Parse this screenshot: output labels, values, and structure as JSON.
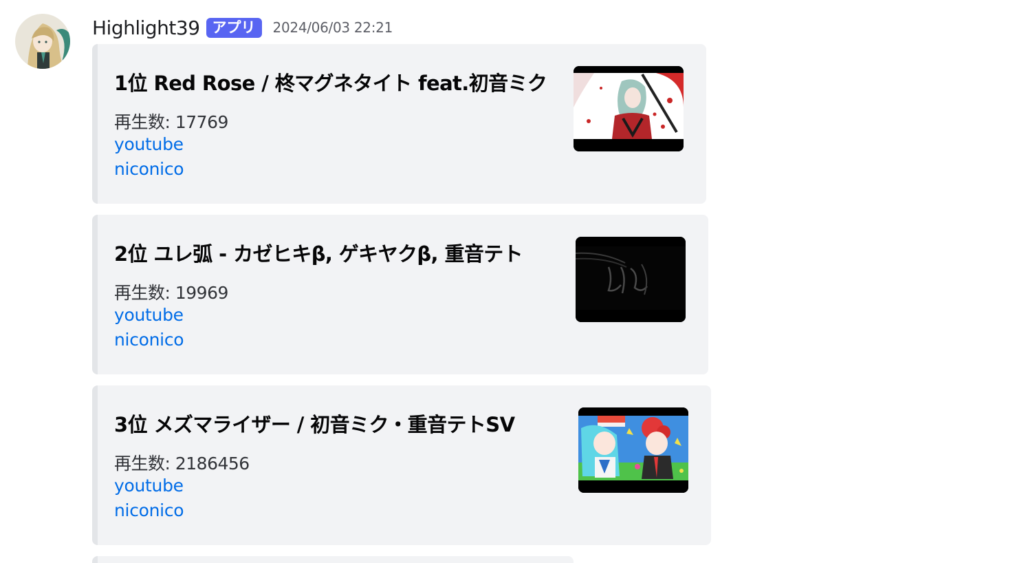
{
  "author": {
    "username": "Highlight39",
    "badge": "アプリ",
    "timestamp": "2024/06/03 22:21",
    "avatar_icon": "anime-character-avatar"
  },
  "embeds": [
    {
      "title": "1位  Red Rose / 柊マグネタイト feat.初音ミク",
      "plays": "再生数: 17769",
      "link_youtube": "youtube",
      "link_niconico": "niconico",
      "thumbnail_icon": "red-rose-thumbnail"
    },
    {
      "title": "2位  ユレ弧 - カゼヒキβ, ゲキヤクβ, 重音テト",
      "plays": "再生数: 19969",
      "link_youtube": "youtube",
      "link_niconico": "niconico",
      "thumbnail_icon": "yure-ko-thumbnail"
    },
    {
      "title": "3位  メズマライザー / 初音ミク・重音テトSV",
      "plays": "再生数: 2186456",
      "link_youtube": "youtube",
      "link_niconico": "niconico",
      "thumbnail_icon": "mesmerizer-thumbnail"
    }
  ],
  "colors": {
    "badge": "#5865f2",
    "link": "#006ce7",
    "embed_bg": "#f2f3f5",
    "embed_border": "#e3e5e8"
  }
}
